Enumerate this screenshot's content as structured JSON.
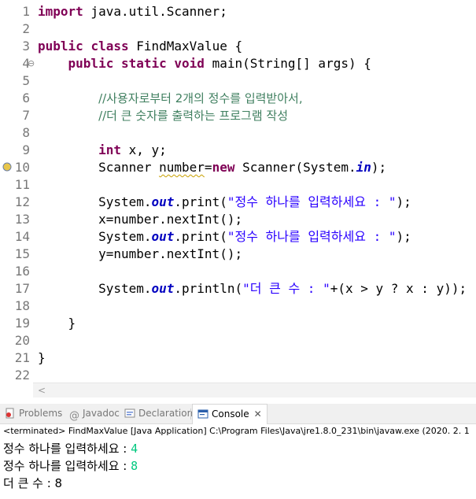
{
  "editor": {
    "lines": [
      {
        "n": "1",
        "segments": [
          {
            "t": "import",
            "c": "kw"
          },
          {
            "t": " java.util.Scanner;"
          }
        ]
      },
      {
        "n": "2",
        "segments": []
      },
      {
        "n": "3",
        "segments": [
          {
            "t": "public",
            "c": "kw"
          },
          {
            "t": " "
          },
          {
            "t": "class",
            "c": "kw"
          },
          {
            "t": " FindMaxValue {"
          }
        ]
      },
      {
        "n": "4",
        "fold": "⊖",
        "segments": [
          {
            "t": "    "
          },
          {
            "t": "public",
            "c": "kw"
          },
          {
            "t": " "
          },
          {
            "t": "static",
            "c": "kw"
          },
          {
            "t": " "
          },
          {
            "t": "void",
            "c": "kw"
          },
          {
            "t": " main(String[] args) {"
          }
        ]
      },
      {
        "n": "5",
        "segments": []
      },
      {
        "n": "6",
        "segments": [
          {
            "t": "        "
          },
          {
            "t": "//사용자로부터 2개의 정수를 입력받아서,",
            "c": "cm"
          }
        ]
      },
      {
        "n": "7",
        "segments": [
          {
            "t": "        "
          },
          {
            "t": "//더 큰 숫자를 출력하는 프로그램 작성",
            "c": "cm"
          }
        ]
      },
      {
        "n": "8",
        "segments": []
      },
      {
        "n": "9",
        "segments": [
          {
            "t": "        "
          },
          {
            "t": "int",
            "c": "kw"
          },
          {
            "t": " x, y;"
          }
        ]
      },
      {
        "n": "10",
        "marker": "warning-marker-icon",
        "segments": [
          {
            "t": "        Scanner "
          },
          {
            "t": "number",
            "c": "warn"
          },
          {
            "t": "="
          },
          {
            "t": "new",
            "c": "kw"
          },
          {
            "t": " Scanner(System."
          },
          {
            "t": "in",
            "c": "fld"
          },
          {
            "t": ");"
          }
        ]
      },
      {
        "n": "11",
        "segments": []
      },
      {
        "n": "12",
        "segments": [
          {
            "t": "        System."
          },
          {
            "t": "out",
            "c": "fld"
          },
          {
            "t": ".print("
          },
          {
            "t": "\"정수 하나를 입력하세요 : \"",
            "c": "str"
          },
          {
            "t": ");"
          }
        ]
      },
      {
        "n": "13",
        "segments": [
          {
            "t": "        x=number.nextInt();"
          }
        ]
      },
      {
        "n": "14",
        "segments": [
          {
            "t": "        System."
          },
          {
            "t": "out",
            "c": "fld"
          },
          {
            "t": ".print("
          },
          {
            "t": "\"정수 하나를 입력하세요 : \"",
            "c": "str"
          },
          {
            "t": ");"
          }
        ]
      },
      {
        "n": "15",
        "segments": [
          {
            "t": "        y=number.nextInt();"
          }
        ]
      },
      {
        "n": "16",
        "segments": []
      },
      {
        "n": "17",
        "segments": [
          {
            "t": "        System."
          },
          {
            "t": "out",
            "c": "fld"
          },
          {
            "t": ".println("
          },
          {
            "t": "\"더 큰 수 : \"",
            "c": "str"
          },
          {
            "t": "+(x > y ? x : y));"
          }
        ]
      },
      {
        "n": "18",
        "segments": []
      },
      {
        "n": "19",
        "segments": [
          {
            "t": "    }"
          }
        ]
      },
      {
        "n": "20",
        "segments": []
      },
      {
        "n": "21",
        "segments": [
          {
            "t": "}"
          }
        ]
      },
      {
        "n": "22",
        "segments": []
      }
    ]
  },
  "scrollbar": {
    "left_arrow": "<"
  },
  "tabs": [
    {
      "label": "Problems",
      "icon": "problems-icon",
      "active": false
    },
    {
      "label": "Javadoc",
      "icon": "at-icon",
      "active": false
    },
    {
      "label": "Declaration",
      "icon": "declaration-icon",
      "active": false
    },
    {
      "label": "Console",
      "icon": "console-icon",
      "active": true,
      "close": "✕"
    }
  ],
  "console": {
    "status": "<terminated> FindMaxValue [Java Application] C:\\Program Files\\Java\\jre1.8.0_231\\bin\\javaw.exe (2020. 2. 1",
    "lines": [
      {
        "prompt": "정수 하나를 입력하세요 : ",
        "input": "4"
      },
      {
        "prompt": "정수 하나를 입력하세요 : ",
        "input": "8"
      },
      {
        "prompt": "더 큰 수 : 8",
        "input": ""
      }
    ]
  },
  "colors": {
    "keyword": "#7f0055",
    "comment": "#3f7f5f",
    "string": "#2a00ff",
    "field": "#0000c0",
    "console_input": "#00c87f"
  }
}
